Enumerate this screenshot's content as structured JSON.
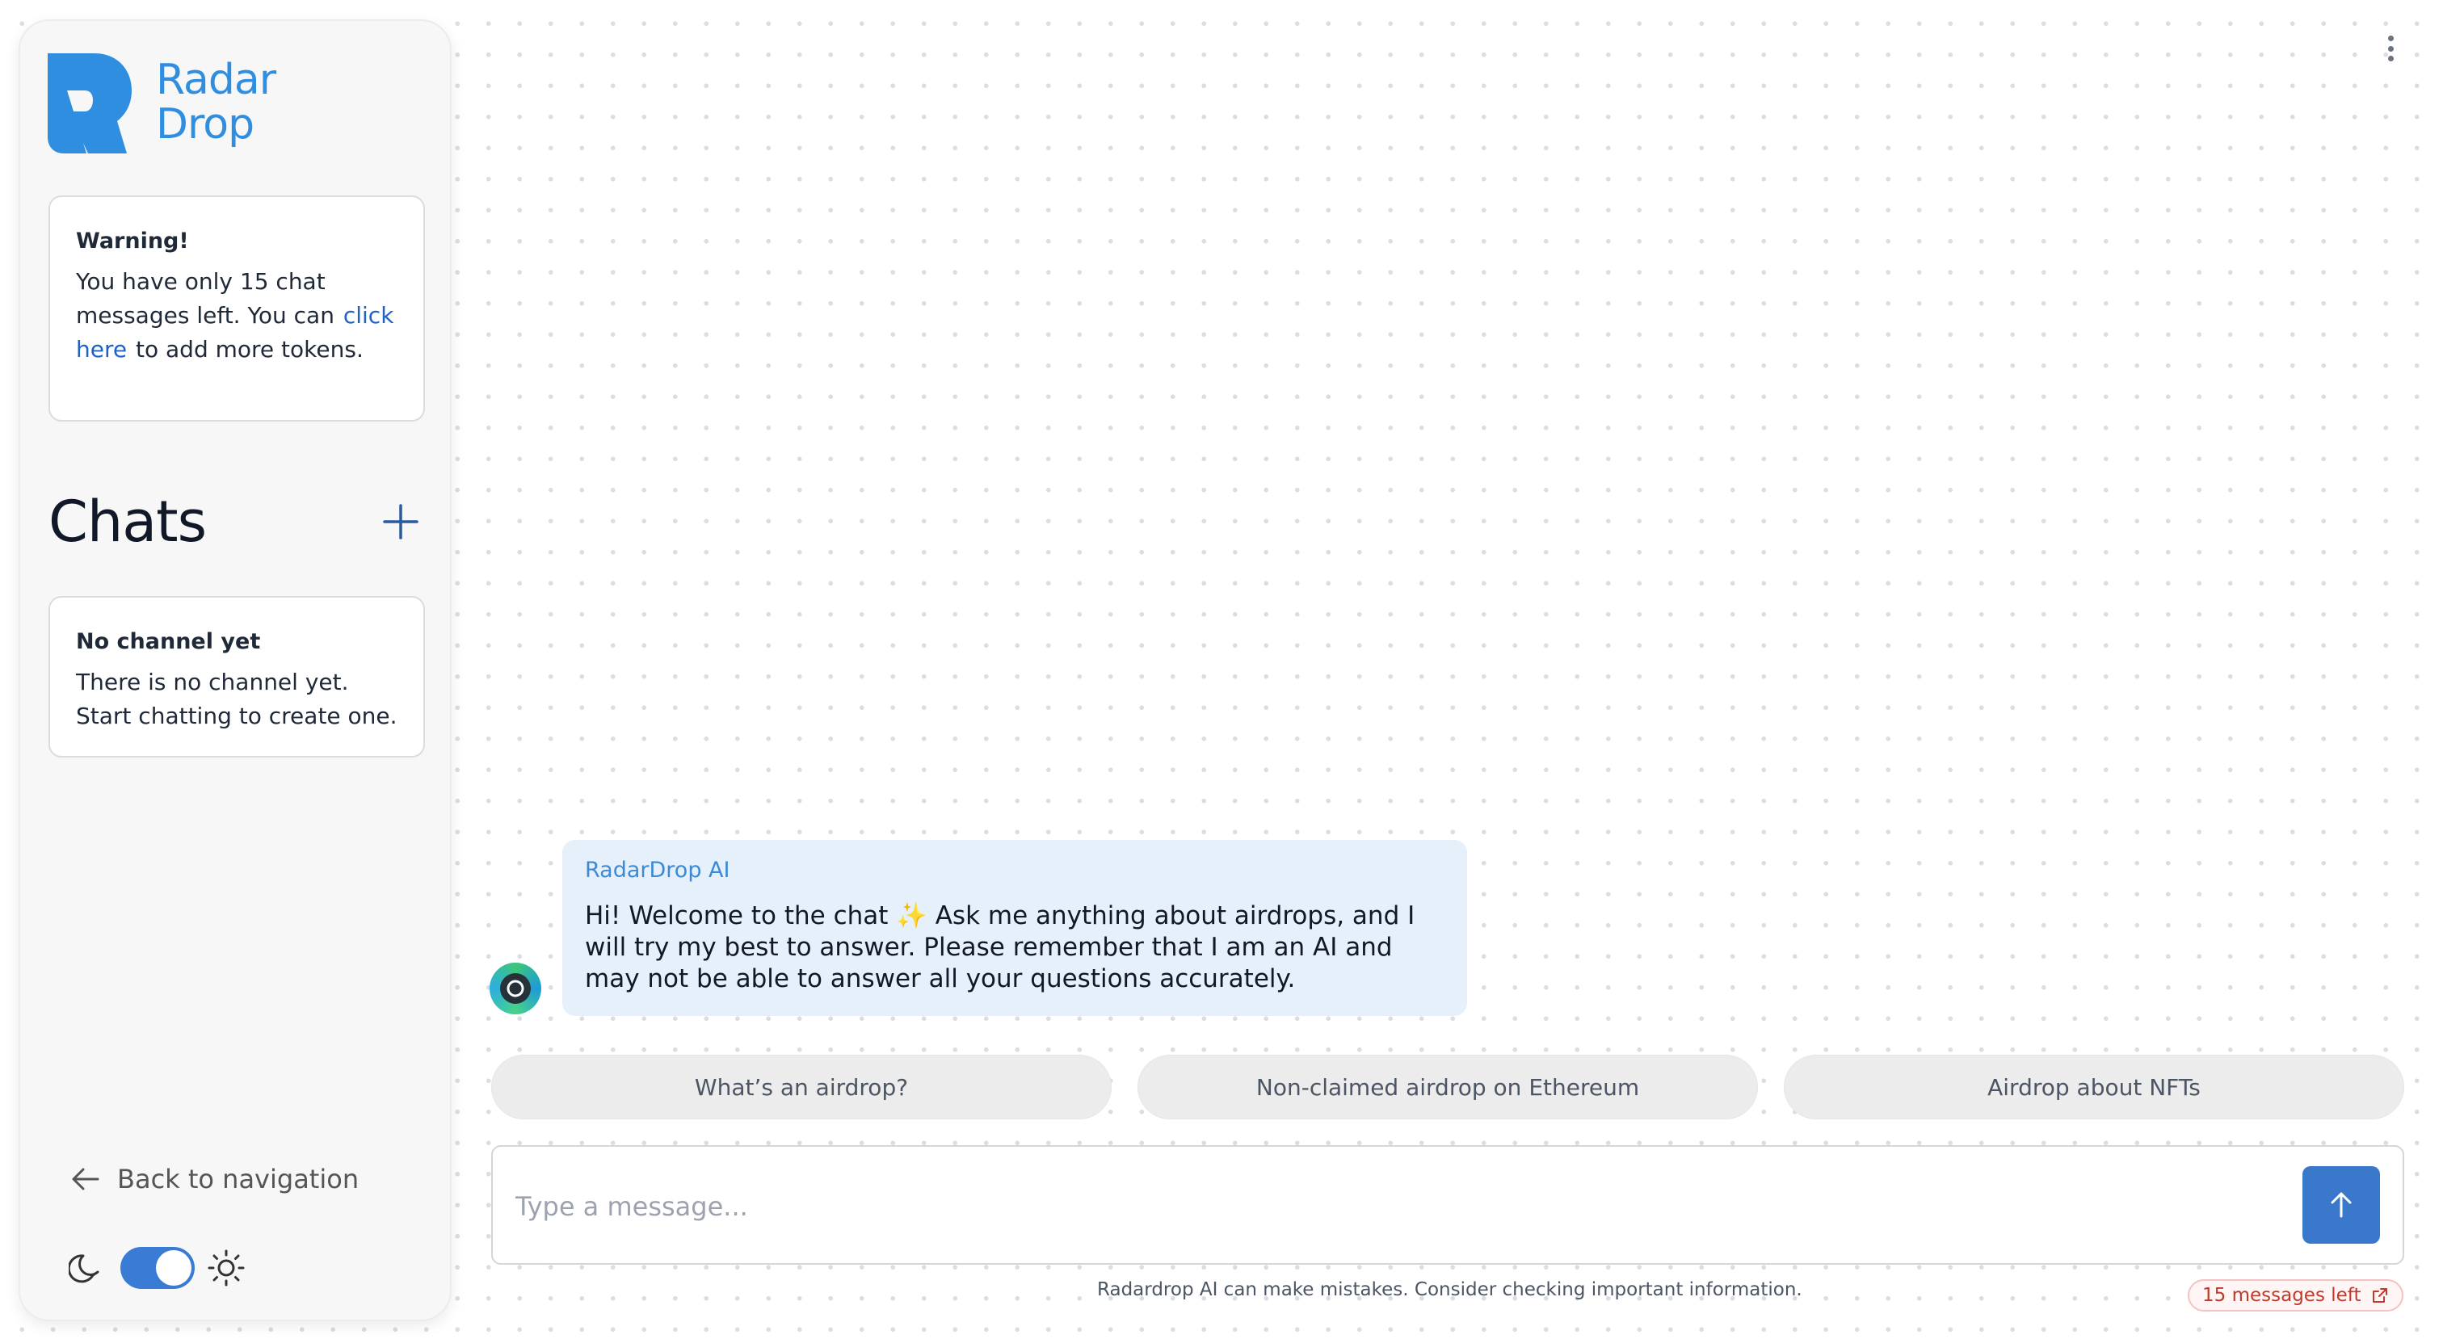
{
  "brand": {
    "line1": "Radar",
    "line2": "Drop",
    "color": "#2f8ee0"
  },
  "warning": {
    "title": "Warning!",
    "text_before": "You have only 15 chat messages left. You can",
    "link": "click here",
    "text_after": "to add more tokens."
  },
  "chats": {
    "title": "Chats",
    "add_icon": "plus-icon"
  },
  "empty_channel": {
    "title": "No channel yet",
    "text": "There is no channel yet. Start chatting to create one."
  },
  "nav": {
    "back_label": "Back to navigation",
    "back_icon": "arrow-left-icon"
  },
  "theme": {
    "dark_icon": "moon-icon",
    "light_icon": "sun-icon",
    "mode": "light",
    "accent": "#3a7bd5"
  },
  "message": {
    "sender": "RadarDrop AI",
    "text": "Hi! Welcome to the chat ✨ Ask me anything about airdrops, and I will try my best to answer. Please remember that I am an AI and may not be able to answer all your questions accurately."
  },
  "suggestions": [
    "What’s an airdrop?",
    "Non-claimed airdrop on Ethereum",
    "Airdrop about NFTs"
  ],
  "composer": {
    "placeholder": "Type a message...",
    "send_icon": "arrow-up-icon"
  },
  "footer": {
    "disclaimer": "Radardrop AI can make mistakes. Consider checking important information.",
    "messages_left": "15 messages left",
    "external_icon": "external-link-icon"
  }
}
